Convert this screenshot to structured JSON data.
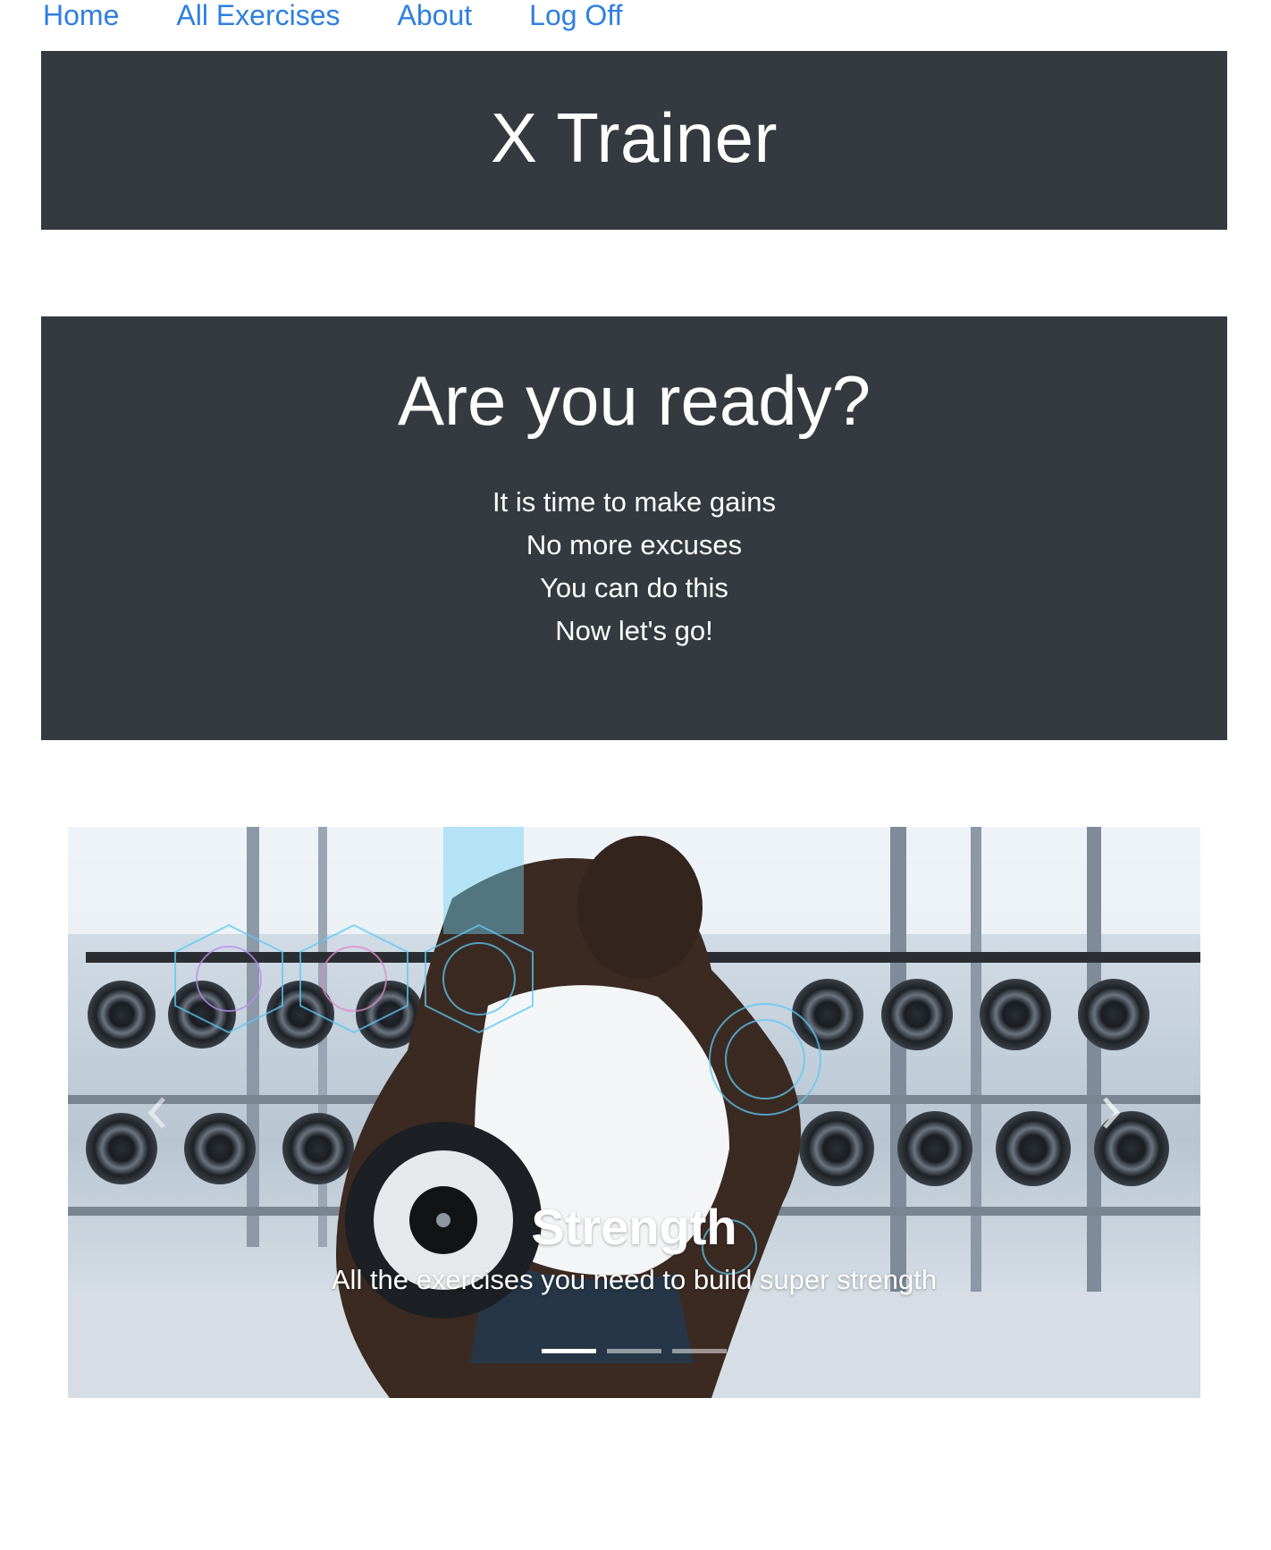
{
  "nav": {
    "items": [
      {
        "label": "Home"
      },
      {
        "label": "All Exercises"
      },
      {
        "label": "About"
      },
      {
        "label": "Log Off"
      }
    ]
  },
  "header": {
    "title": "X Trainer"
  },
  "hero": {
    "heading": "Are you ready?",
    "lines": [
      "It is time to make gains",
      "No more excuses",
      "You can do this",
      "Now let's go!"
    ]
  },
  "carousel": {
    "active_slide": 0,
    "slide_count": 3,
    "caption_title": "Strength",
    "caption_text": "All the exercises you need to build super strength",
    "prev_icon": "chevron-left-icon",
    "next_icon": "chevron-right-icon"
  },
  "colors": {
    "link": "#2f7fe0",
    "panel_bg": "#343a40",
    "text_on_dark": "#ffffff"
  }
}
